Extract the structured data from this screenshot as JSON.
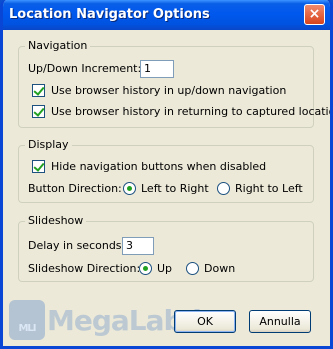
{
  "window": {
    "title": "Location Navigator Options",
    "close_label": "×"
  },
  "navigation": {
    "legend": "Navigation",
    "increment_label": "Up/Down Increment:",
    "increment_value": "1",
    "history_updown_label": "Use browser history in up/down navigation",
    "history_updown_checked": true,
    "history_return_label": "Use browser history in returning to captured location",
    "history_return_checked": true
  },
  "display": {
    "legend": "Display",
    "hide_buttons_label": "Hide navigation buttons when disabled",
    "hide_buttons_checked": true,
    "direction_label": "Button Direction:",
    "left_to_right_label": "Left to Right",
    "right_to_left_label": "Right to Left",
    "selected": "Left to Right"
  },
  "slideshow": {
    "legend": "Slideshow",
    "delay_label": "Delay in seconds:",
    "delay_value": "3",
    "direction_label": "Slideshow Direction:",
    "up_label": "Up",
    "down_label": "Down",
    "selected": "Up"
  },
  "buttons": {
    "ok_label": "OK",
    "cancel_label": "Annulla"
  },
  "watermark": {
    "text": "MegaLab.it",
    "badge": "MLI"
  }
}
